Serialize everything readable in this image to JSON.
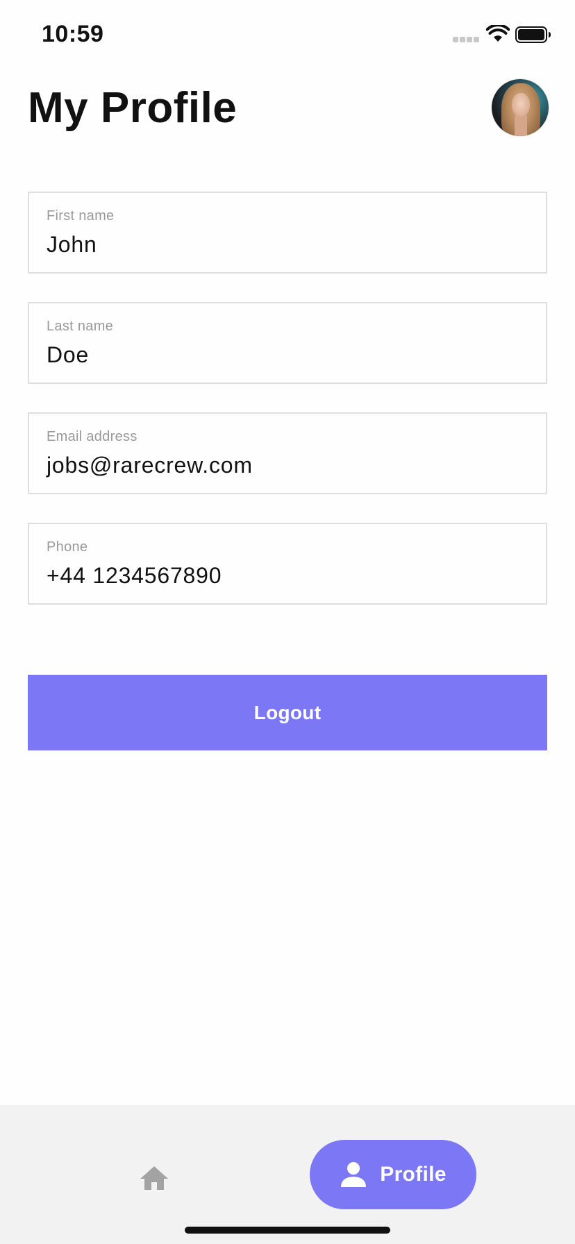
{
  "status_bar": {
    "time": "10:59",
    "icons": [
      "signal-icon",
      "wifi-icon",
      "battery-icon"
    ]
  },
  "header": {
    "title": "My Profile",
    "avatar_icon": "avatar"
  },
  "form": {
    "fields": [
      {
        "label": "First name",
        "value": "John"
      },
      {
        "label": "Last name",
        "value": "Doe"
      },
      {
        "label": "Email address",
        "value": "jobs@rarecrew.com"
      },
      {
        "label": "Phone",
        "value": "+44 1234567890"
      }
    ],
    "logout_label": "Logout"
  },
  "bottom_nav": {
    "items": [
      {
        "icon": "home-icon",
        "label": ""
      },
      {
        "icon": "person-icon",
        "label": "Profile",
        "active": true
      }
    ]
  },
  "colors": {
    "accent": "#7b77f5",
    "nav_background": "#f2f2f2",
    "field_border": "#dedede",
    "label_gray": "#9a9a9a",
    "inactive_icon": "#a3a3a3"
  }
}
